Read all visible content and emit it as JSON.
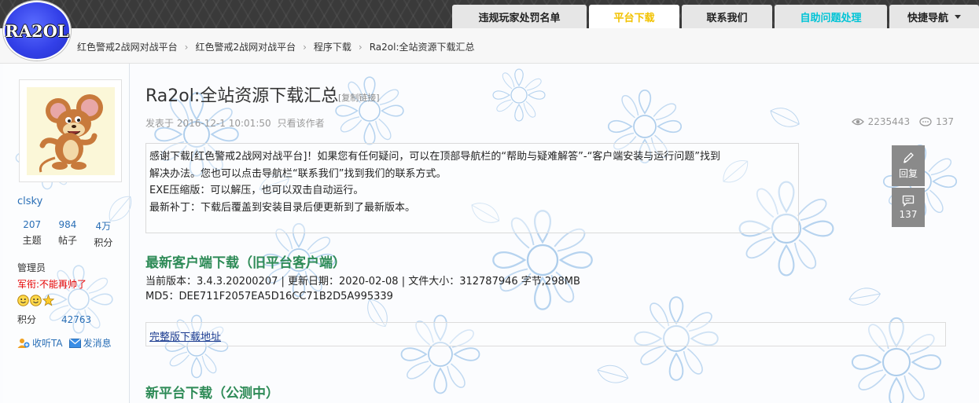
{
  "logo": {
    "text": "RA2OL"
  },
  "nav": {
    "tabs": [
      {
        "label": "违规玩家处罚名单",
        "active": false,
        "cyan": false
      },
      {
        "label": "平台下载",
        "active": true,
        "cyan": false
      },
      {
        "label": "联系我们",
        "active": false,
        "cyan": false
      },
      {
        "label": "自助问题处理",
        "active": false,
        "cyan": true
      },
      {
        "label": "快捷导航",
        "active": false,
        "cyan": false,
        "dropdown": true
      }
    ]
  },
  "breadcrumb": {
    "items": [
      "红色警戒2战网对战平台",
      "红色警戒2战网对战平台",
      "程序下载",
      "Ra2ol:全站资源下载汇总"
    ]
  },
  "user": {
    "name": "clsky",
    "stats": [
      {
        "value": "207",
        "label": "主题"
      },
      {
        "value": "984",
        "label": "帖子"
      },
      {
        "value": "4万",
        "label": "积分"
      }
    ],
    "role": "管理员",
    "title": "军衔:不能再帅了",
    "score_label": "积分",
    "score_value": "42763",
    "follow_label": "收听TA",
    "message_label": "发消息"
  },
  "post": {
    "title": "Ra2ol:全站资源下载汇总",
    "copy_link": "[复制链接]",
    "posted": "发表于 2016-12-1 10:01:50",
    "only_author": "只看该作者",
    "views": "2235443",
    "replies": "137",
    "notice": [
      "感谢下载[红色警戒2战网对战平台]！如果您有任何疑问，可以在顶部导航栏的“帮助与疑难解答”-“客户端安装与运行问题”找到",
      "解决办法。您也可以点击导航栏“联系我们”找到我们的联系方式。",
      "EXE压缩版：可以解压，也可以双击自动运行。",
      "最新补丁：下载后覆盖到安装目录后便更新到了最新版本。"
    ],
    "section1_heading": "最新客户端下载（旧平台客户端）",
    "section1_info": "当前版本：3.4.3.20200207  |  更新日期：2020-02-08  |  文件大小：312787946 字节,298MB",
    "section1_md5": "MD5：DEE711F2057EA5D16CC71B2D5A995339",
    "download_link": "完整版下载地址",
    "section2_heading": "新平台下载（公测中）"
  },
  "side": {
    "reply_label": "回复",
    "comment_count": "137"
  },
  "colors": {
    "accent_green": "#2e8b57",
    "link_blue": "#2a6fb6",
    "active_tab": "#f2c200",
    "cyan_tab": "#00c4d6"
  }
}
